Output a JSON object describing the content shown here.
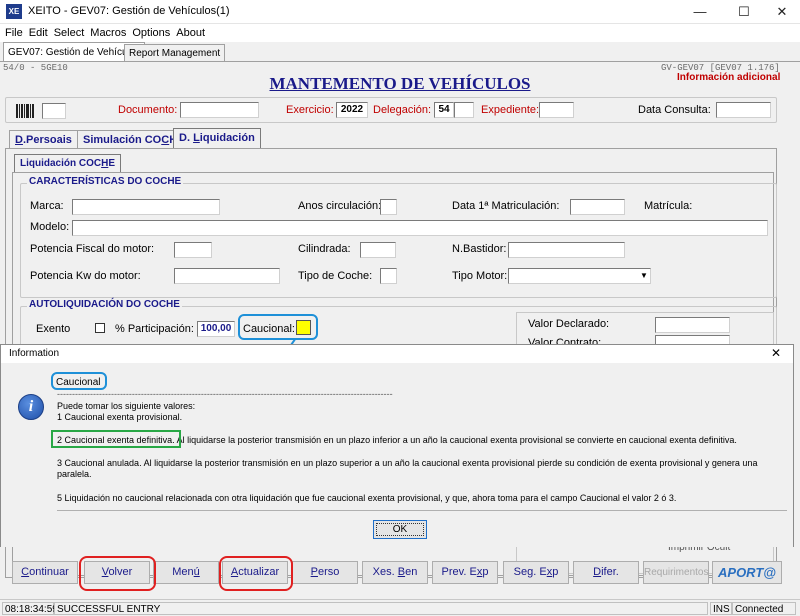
{
  "window": {
    "app_icon_text": "XE",
    "title": "XEITO - GEV07: Gestión de Vehículos(1)",
    "minimize": "—",
    "maximize": "☐",
    "close": "✕"
  },
  "menu": [
    "File",
    "Edit",
    "Select",
    "Macros",
    "Options",
    "About"
  ],
  "doc_tabs": [
    "GEV07: Gestión de Vehículos",
    "Report Management"
  ],
  "header": {
    "left_code": "54/0 - 5GE10",
    "right_code": "GV-GEV07 [GEV07 1.176]",
    "info_link": "Información adicional",
    "title": "MANTEMENTO DE VEHÍCULOS"
  },
  "toolbar": {
    "barcode_icon": "barcode-icon",
    "documento_label": "Documento:",
    "documento_value": "",
    "exercicio_label": "Exercicio:",
    "exercicio_value": "2022",
    "delegacion_label": "Delegación:",
    "delegacion_value": "54",
    "expediente_label": "Expediente:",
    "expediente_value": "",
    "data_consulta_label": "Data Consulta:",
    "data_consulta_value": ""
  },
  "tabs": {
    "persoais": {
      "pre": "",
      "key": "D",
      "post": ".Persoais"
    },
    "simulacion": {
      "pre": "Simulación CO",
      "key": "C",
      "post": "HE"
    },
    "liquidacion": {
      "pre": "D. ",
      "key": "L",
      "post": "iquidación"
    }
  },
  "subtab": {
    "pre": "Liquidación COC",
    "key": "H",
    "post": "E"
  },
  "caracteristicas": {
    "title": "CARACTERÍSTICAS DO COCHE",
    "marca": "Marca:",
    "anos_circulacion": "Anos circulación:",
    "data_matriculacion": "Data 1ª Matriculación:",
    "matricula": "Matrícula:",
    "modelo": "Modelo:",
    "potencia_fiscal": "Potencia Fiscal do motor:",
    "cilindrada": "Cilindrada:",
    "n_bastidor": "N.Bastidor:",
    "potencia_kw": "Potencia Kw do motor:",
    "tipo_coche": "Tipo de Coche:",
    "tipo_motor": "Tipo Motor:"
  },
  "autoliquidacion": {
    "title": "AUTOLIQUIDACIÓN DO COCHE",
    "exento": "Exento",
    "participacion_label": "% Participación:",
    "participacion_value": "100,00",
    "caucional_label": "Caucional:",
    "valor_declarado": "Valor Declarado:",
    "valor_contrato": "Valor Contrato:",
    "imprimir_ocultar": "Imprimir Ocult"
  },
  "dialog": {
    "title": "Information",
    "close": "✕",
    "field_name": "Caucional",
    "separator": "----------------------------------------------------------------------------------------------------------------",
    "intro": "Puede tomar los siguiente valores:",
    "opt1": "1  Caucional exenta provisional.",
    "opt2_highlight": "2  Caucional exenta definitiva.",
    "opt2_rest": " Al liquidarse la posterior  transmisión en un plazo inferior a un año la caucional exenta  provisional se convierte en caucional exenta definitiva.",
    "opt3": "3  Caucional anulada. Al liquidarse la posterior transmisión en un plazo superior a un año la caucional exenta provisional pierde su condición de exenta provisional y genera una paralela.",
    "opt5": "5  Liquidación no caucional relacionada con otra liquidación que fue caucional exenta provisional, y que, ahora toma para el campo Caucional el valor 2 ó 3.",
    "ok": "OK"
  },
  "buttons": {
    "continuar": {
      "pre": "",
      "key": "C",
      "post": "ontinuar"
    },
    "volver": {
      "pre": "",
      "key": "V",
      "post": "olver"
    },
    "menu": {
      "pre": "Men",
      "key": "ú",
      "post": ""
    },
    "actualizar": {
      "pre": "",
      "key": "A",
      "post": "ctualizar"
    },
    "perso": {
      "pre": "",
      "key": "P",
      "post": "erso"
    },
    "xes_ben": {
      "pre": "Xes. ",
      "key": "B",
      "post": "en"
    },
    "prev_exp": {
      "pre": "Prev. E",
      "key": "x",
      "post": "p"
    },
    "seg_exp": {
      "pre": "Seg. E",
      "key": "x",
      "post": "p"
    },
    "difer": {
      "pre": "",
      "key": "D",
      "post": "ifer."
    },
    "requirimentos": "Requirimentos",
    "aporta": "APORT@"
  },
  "status": {
    "time": "08:18:34:597",
    "message": "SUCCESSFUL ENTRY",
    "ins": "INS",
    "connection": "Connected"
  },
  "colors": {
    "accent_blue": "#1a1a8a",
    "header_red": "#c00000",
    "highlight_red": "#e02020",
    "highlight_blue": "#1e90d8",
    "highlight_green": "#28a745",
    "caucional_yellow": "#ffff00"
  }
}
